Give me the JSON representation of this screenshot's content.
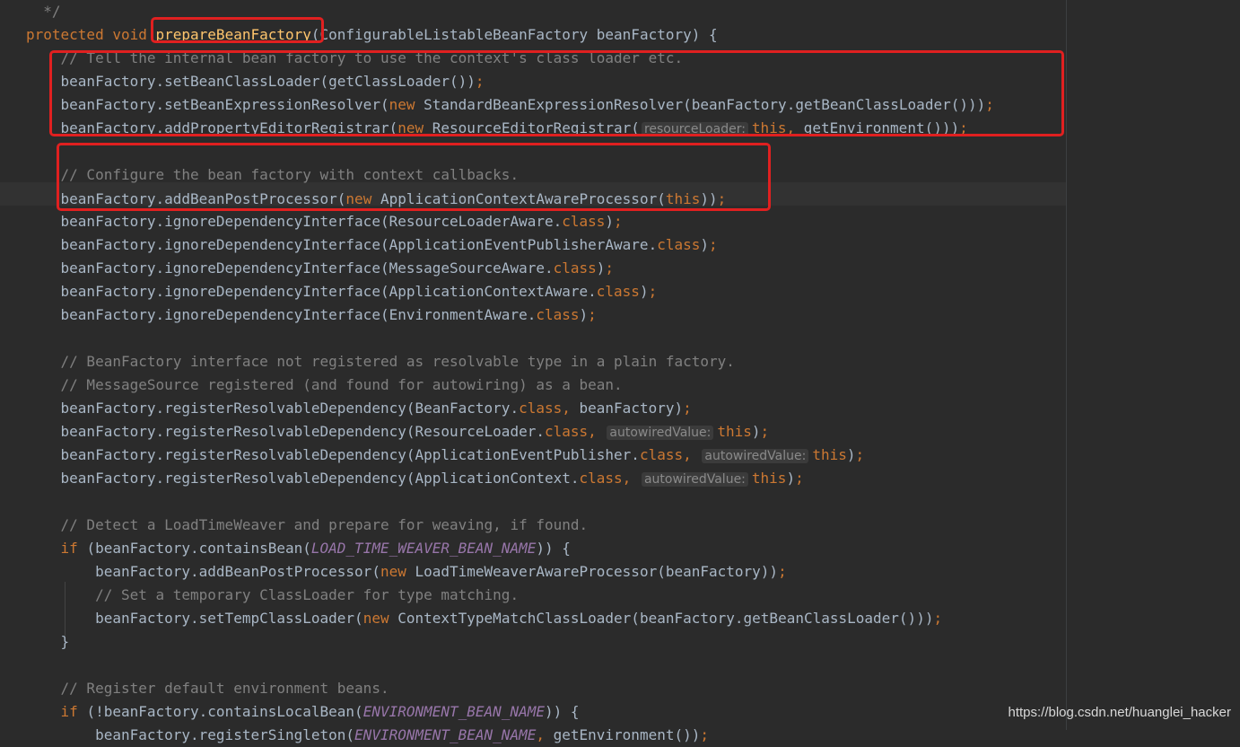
{
  "editor": {
    "language": "java",
    "colors": {
      "background": "#2b2b2b",
      "plain": "#a9b7c6",
      "keyword": "#cc7832",
      "comment": "#808080",
      "method_declaration": "#ffc66d",
      "constant": "#9876aa",
      "annotation_box": "#e02020"
    },
    "lines": [
      {
        "indent": "  ",
        "tokens": [
          {
            "type": "comment",
            "text": "*/"
          }
        ]
      },
      {
        "indent": "",
        "tokens": [
          {
            "type": "keyword",
            "text": "protected "
          },
          {
            "type": "keyword",
            "text": "void "
          },
          {
            "type": "method",
            "text": "prepareBeanFactory"
          },
          {
            "type": "plain",
            "text": "(ConfigurableListableBeanFactory beanFactory) {"
          }
        ]
      },
      {
        "indent": "    ",
        "tokens": [
          {
            "type": "comment",
            "text": "// Tell the internal bean factory to use the context's class loader etc."
          }
        ]
      },
      {
        "indent": "    ",
        "tokens": [
          {
            "type": "plain",
            "text": "beanFactory.setBeanClassLoader(getClassLoader())"
          },
          {
            "type": "keyword",
            "text": ";"
          }
        ]
      },
      {
        "indent": "    ",
        "tokens": [
          {
            "type": "plain",
            "text": "beanFactory.setBeanExpressionResolver("
          },
          {
            "type": "keyword",
            "text": "new "
          },
          {
            "type": "plain",
            "text": "StandardBeanExpressionResolver(beanFactory.getBeanClassLoader()))"
          },
          {
            "type": "keyword",
            "text": ";"
          }
        ]
      },
      {
        "indent": "    ",
        "tokens": [
          {
            "type": "plain",
            "text": "beanFactory.addPropertyEditorRegistrar("
          },
          {
            "type": "keyword",
            "text": "new "
          },
          {
            "type": "plain",
            "text": "ResourceEditorRegistrar("
          },
          {
            "type": "hint",
            "text": "resourceLoader:"
          },
          {
            "type": "keyword",
            "text": "this, "
          },
          {
            "type": "plain",
            "text": "getEnvironment()))"
          },
          {
            "type": "keyword",
            "text": ";"
          }
        ]
      },
      {
        "indent": "",
        "tokens": []
      },
      {
        "indent": "    ",
        "tokens": [
          {
            "type": "comment",
            "text": "// Configure the bean factory with context callbacks."
          }
        ]
      },
      {
        "indent": "    ",
        "caret": true,
        "tokens": [
          {
            "type": "plain",
            "text": "beanFactory.addBeanPostProcessor("
          },
          {
            "type": "keyword",
            "text": "new "
          },
          {
            "type": "plain",
            "text": "ApplicationContextAwareProcessor("
          },
          {
            "type": "keyword",
            "text": "this"
          },
          {
            "type": "plain",
            "text": "))"
          },
          {
            "type": "keyword",
            "text": ";"
          }
        ]
      },
      {
        "indent": "    ",
        "tokens": [
          {
            "type": "plain",
            "text": "beanFactory.ignoreDependencyInterface(ResourceLoaderAware."
          },
          {
            "type": "keyword",
            "text": "class"
          },
          {
            "type": "plain",
            "text": ")"
          },
          {
            "type": "keyword",
            "text": ";"
          }
        ]
      },
      {
        "indent": "    ",
        "tokens": [
          {
            "type": "plain",
            "text": "beanFactory.ignoreDependencyInterface(ApplicationEventPublisherAware."
          },
          {
            "type": "keyword",
            "text": "class"
          },
          {
            "type": "plain",
            "text": ")"
          },
          {
            "type": "keyword",
            "text": ";"
          }
        ]
      },
      {
        "indent": "    ",
        "tokens": [
          {
            "type": "plain",
            "text": "beanFactory.ignoreDependencyInterface(MessageSourceAware."
          },
          {
            "type": "keyword",
            "text": "class"
          },
          {
            "type": "plain",
            "text": ")"
          },
          {
            "type": "keyword",
            "text": ";"
          }
        ]
      },
      {
        "indent": "    ",
        "tokens": [
          {
            "type": "plain",
            "text": "beanFactory.ignoreDependencyInterface(ApplicationContextAware."
          },
          {
            "type": "keyword",
            "text": "class"
          },
          {
            "type": "plain",
            "text": ")"
          },
          {
            "type": "keyword",
            "text": ";"
          }
        ]
      },
      {
        "indent": "    ",
        "tokens": [
          {
            "type": "plain",
            "text": "beanFactory.ignoreDependencyInterface(EnvironmentAware."
          },
          {
            "type": "keyword",
            "text": "class"
          },
          {
            "type": "plain",
            "text": ")"
          },
          {
            "type": "keyword",
            "text": ";"
          }
        ]
      },
      {
        "indent": "",
        "tokens": []
      },
      {
        "indent": "    ",
        "tokens": [
          {
            "type": "comment",
            "text": "// BeanFactory interface not registered as resolvable type in a plain factory."
          }
        ]
      },
      {
        "indent": "    ",
        "tokens": [
          {
            "type": "comment",
            "text": "// MessageSource registered (and found for autowiring) as a bean."
          }
        ]
      },
      {
        "indent": "    ",
        "tokens": [
          {
            "type": "plain",
            "text": "beanFactory.registerResolvableDependency(BeanFactory."
          },
          {
            "type": "keyword",
            "text": "class, "
          },
          {
            "type": "plain",
            "text": "beanFactory)"
          },
          {
            "type": "keyword",
            "text": ";"
          }
        ]
      },
      {
        "indent": "    ",
        "tokens": [
          {
            "type": "plain",
            "text": "beanFactory.registerResolvableDependency(ResourceLoader."
          },
          {
            "type": "keyword",
            "text": "class, "
          },
          {
            "type": "hint",
            "text": "autowiredValue:"
          },
          {
            "type": "keyword",
            "text": "this"
          },
          {
            "type": "plain",
            "text": ")"
          },
          {
            "type": "keyword",
            "text": ";"
          }
        ]
      },
      {
        "indent": "    ",
        "tokens": [
          {
            "type": "plain",
            "text": "beanFactory.registerResolvableDependency(ApplicationEventPublisher."
          },
          {
            "type": "keyword",
            "text": "class, "
          },
          {
            "type": "hint",
            "text": "autowiredValue:"
          },
          {
            "type": "keyword",
            "text": "this"
          },
          {
            "type": "plain",
            "text": ")"
          },
          {
            "type": "keyword",
            "text": ";"
          }
        ]
      },
      {
        "indent": "    ",
        "tokens": [
          {
            "type": "plain",
            "text": "beanFactory.registerResolvableDependency(ApplicationContext."
          },
          {
            "type": "keyword",
            "text": "class, "
          },
          {
            "type": "hint",
            "text": "autowiredValue:"
          },
          {
            "type": "keyword",
            "text": "this"
          },
          {
            "type": "plain",
            "text": ")"
          },
          {
            "type": "keyword",
            "text": ";"
          }
        ]
      },
      {
        "indent": "",
        "tokens": []
      },
      {
        "indent": "    ",
        "tokens": [
          {
            "type": "comment",
            "text": "// Detect a LoadTimeWeaver and prepare for weaving, if found."
          }
        ]
      },
      {
        "indent": "    ",
        "tokens": [
          {
            "type": "keyword",
            "text": "if "
          },
          {
            "type": "plain",
            "text": "(beanFactory.containsBean("
          },
          {
            "type": "const",
            "text": "LOAD_TIME_WEAVER_BEAN_NAME"
          },
          {
            "type": "plain",
            "text": ")) {"
          }
        ]
      },
      {
        "indent": "        ",
        "tokens": [
          {
            "type": "plain",
            "text": "beanFactory.addBeanPostProcessor("
          },
          {
            "type": "keyword",
            "text": "new "
          },
          {
            "type": "plain",
            "text": "LoadTimeWeaverAwareProcessor(beanFactory))"
          },
          {
            "type": "keyword",
            "text": ";"
          }
        ]
      },
      {
        "indent": "        ",
        "tokens": [
          {
            "type": "comment",
            "text": "// Set a temporary ClassLoader for type matching."
          }
        ]
      },
      {
        "indent": "        ",
        "tokens": [
          {
            "type": "plain",
            "text": "beanFactory.setTempClassLoader("
          },
          {
            "type": "keyword",
            "text": "new "
          },
          {
            "type": "plain",
            "text": "ContextTypeMatchClassLoader(beanFactory.getBeanClassLoader()))"
          },
          {
            "type": "keyword",
            "text": ";"
          }
        ]
      },
      {
        "indent": "    ",
        "tokens": [
          {
            "type": "plain",
            "text": "}"
          }
        ]
      },
      {
        "indent": "",
        "tokens": []
      },
      {
        "indent": "    ",
        "tokens": [
          {
            "type": "comment",
            "text": "// Register default environment beans."
          }
        ]
      },
      {
        "indent": "    ",
        "tokens": [
          {
            "type": "keyword",
            "text": "if "
          },
          {
            "type": "plain",
            "text": "(!beanFactory.containsLocalBean("
          },
          {
            "type": "const",
            "text": "ENVIRONMENT_BEAN_NAME"
          },
          {
            "type": "plain",
            "text": ")) {"
          }
        ]
      },
      {
        "indent": "        ",
        "tokens": [
          {
            "type": "plain",
            "text": "beanFactory.registerSingleton("
          },
          {
            "type": "const",
            "text": "ENVIRONMENT_BEAN_NAME"
          },
          {
            "type": "keyword",
            "text": ", "
          },
          {
            "type": "plain",
            "text": "getEnvironment())"
          },
          {
            "type": "keyword",
            "text": ";"
          }
        ]
      }
    ]
  },
  "watermark": "https://blog.csdn.net/huanglei_hacker"
}
